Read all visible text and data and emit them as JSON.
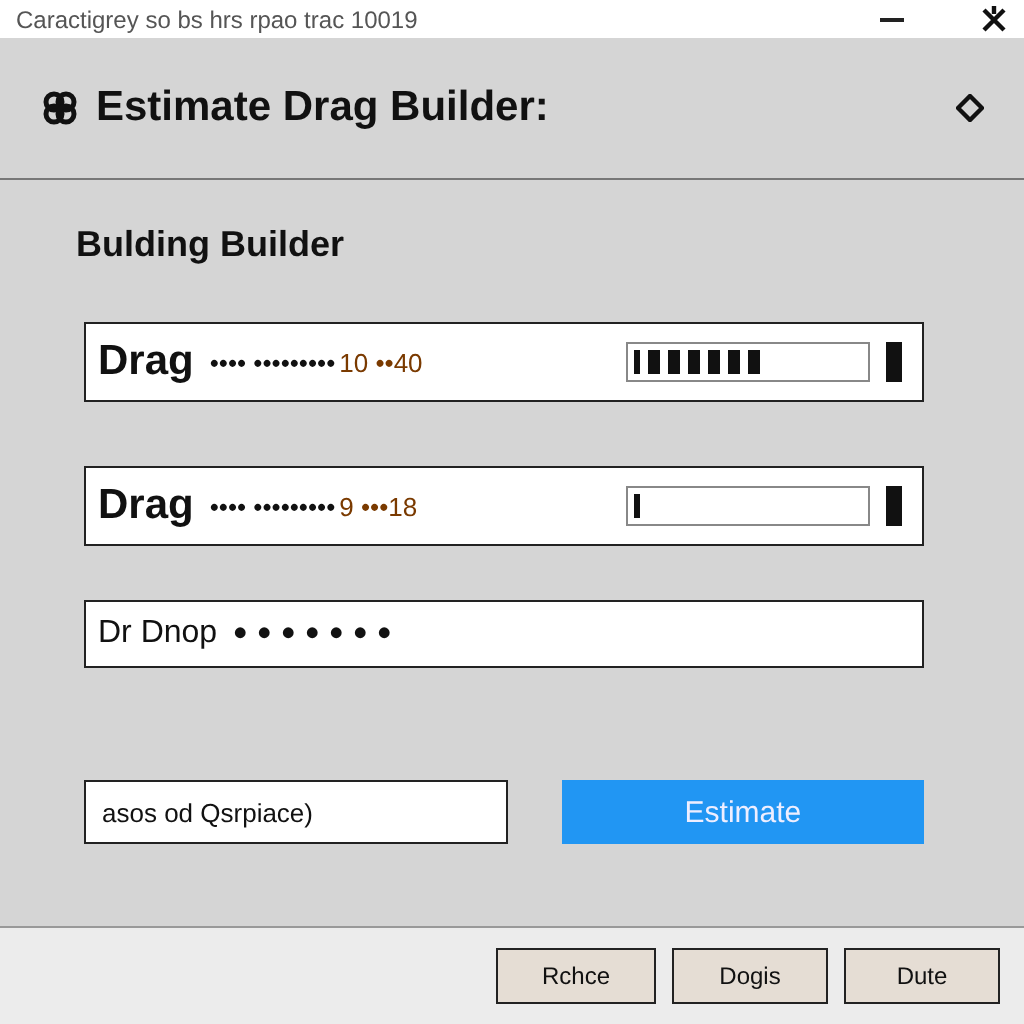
{
  "title_bar": {
    "title": "Caractigrey so bs hrs rpao trac 10019"
  },
  "header": {
    "title": "Estimate Drag Builder:"
  },
  "section_title": "Bulding Builder",
  "rows": [
    {
      "label": "Drag",
      "dots": "•••• •••••••••",
      "reading": "10 ••40",
      "level": 0.55
    },
    {
      "label": "Drag",
      "dots": "•••• •••••••••",
      "reading": "9 •••18",
      "level": 0.05
    }
  ],
  "password": {
    "label": "Dr Dnop",
    "value": "•••••••"
  },
  "input": {
    "value": "asos od Qsrpiace)"
  },
  "primary_button": "Estimate",
  "footer_buttons": [
    "Rchce",
    "Dogis",
    "Dute"
  ]
}
